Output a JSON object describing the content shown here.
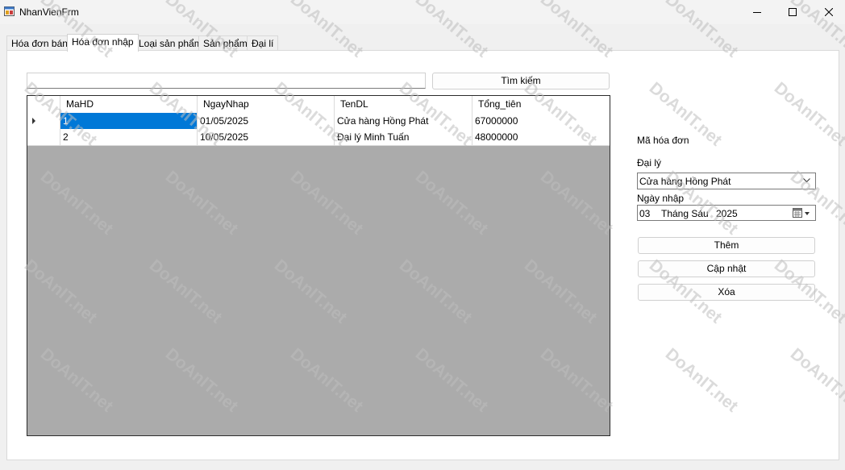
{
  "window": {
    "title": "NhanVienFrm"
  },
  "tabs": [
    {
      "label": "Hóa đơn bán"
    },
    {
      "label": "Hóa đơn nhập"
    },
    {
      "label": "Loại sản phẩm"
    },
    {
      "label": "Sản phẩm"
    },
    {
      "label": "Đại lí"
    }
  ],
  "active_tab_index": 1,
  "search": {
    "value": "",
    "button_label": "Tìm kiếm"
  },
  "grid": {
    "columns": [
      "MaHD",
      "NgayNhap",
      "TenDL",
      "Tổng_tiên"
    ],
    "rows": [
      [
        "1",
        "01/05/2025",
        "Cửa hàng Hồng Phát",
        "67000000"
      ],
      [
        "2",
        "10/05/2025",
        "Đại lý Minh Tuấn",
        "48000000"
      ]
    ],
    "selected_row_index": 0
  },
  "form": {
    "ma_hoa_don_label": "Mã hóa đơn",
    "dai_ly_label": "Đại lý",
    "dai_ly_value": "Cửa hàng Hồng Phát",
    "ngay_nhap_label": "Ngày nhập",
    "date": {
      "day": "03",
      "month": "Tháng Sáu",
      "year": "2025"
    },
    "buttons": {
      "add": "Thêm",
      "update": "Cập nhật",
      "delete": "Xóa"
    }
  },
  "watermark": "DoAnIT.net",
  "colors": {
    "selection": "#0078d7",
    "grid_background": "#ababab"
  }
}
